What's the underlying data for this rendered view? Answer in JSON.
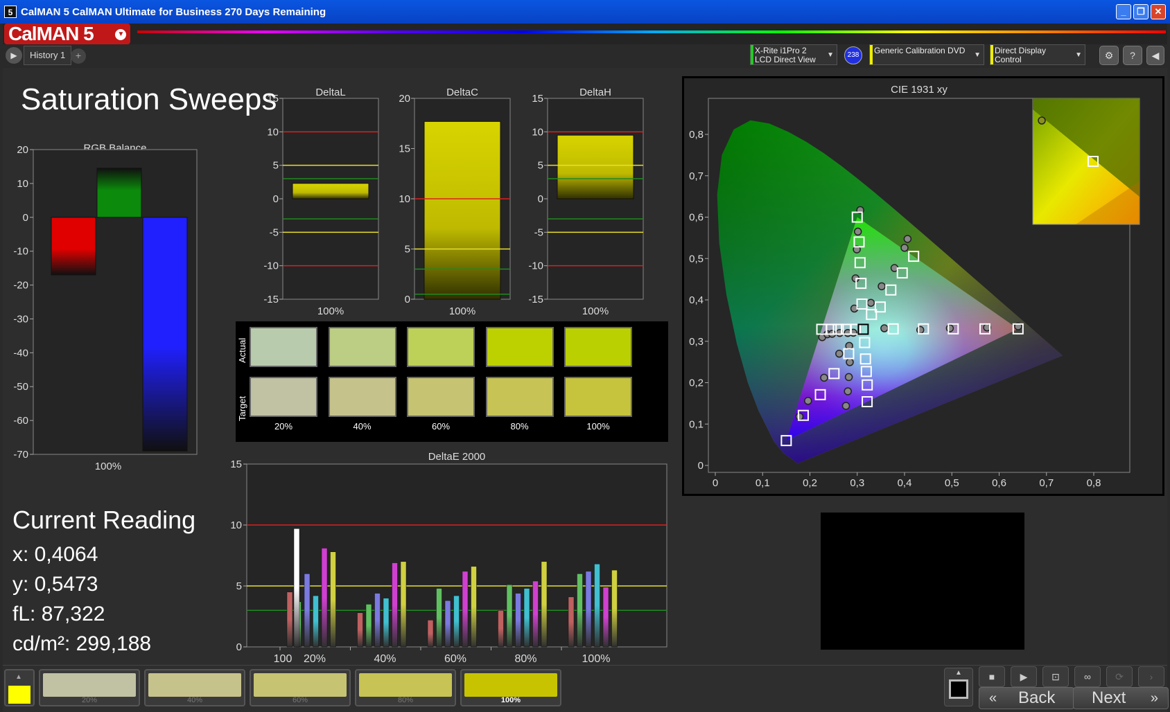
{
  "window": {
    "title": "CalMAN 5 CalMAN Ultimate for Business 270 Days Remaining",
    "app_icon": "5",
    "minimize": "_",
    "maximize": "❐",
    "close": "✕"
  },
  "logo": {
    "text": "CalMAN 5"
  },
  "tabs": [
    {
      "label": "History 1"
    }
  ],
  "devices": {
    "meter": {
      "line1": "X-Rite i1Pro 2",
      "line2": "LCD Direct View",
      "badge": "238",
      "color": "#22cc22"
    },
    "source": {
      "line1": "Generic Calibration DVD",
      "color": "#eeee00"
    },
    "display": {
      "line1": "Direct Display Control",
      "color": "#eeee00"
    }
  },
  "icons": {
    "settings": "gear-icon",
    "help": "?",
    "collapse": "chevron-left-icon"
  },
  "page": {
    "title": "Saturation Sweeps"
  },
  "rgb_balance": {
    "title": "RGB Balance",
    "ylim": [
      -70,
      20
    ],
    "yticks": [
      "20",
      "10",
      "0",
      "-10",
      "-20",
      "-30",
      "-40",
      "-50",
      "-60",
      "-70"
    ],
    "category": "100%",
    "bars": [
      {
        "name": "red",
        "value": -17,
        "color": "#e00000"
      },
      {
        "name": "green",
        "value": 14.5,
        "color": "#0b8a0b"
      },
      {
        "name": "blue",
        "value": -69,
        "color": "#2020ff"
      }
    ]
  },
  "delta_charts": [
    {
      "title": "DeltaL",
      "ylim": [
        -15,
        15
      ],
      "yticks": [
        "15",
        "10",
        "5",
        "0",
        "-5",
        "-10",
        "-15"
      ],
      "value": 2.3,
      "category": "100%"
    },
    {
      "title": "DeltaC",
      "ylim": [
        0,
        20
      ],
      "yticks": [
        "20",
        "15",
        "10",
        "5",
        "0"
      ],
      "value": 17.7,
      "category": "100%"
    },
    {
      "title": "DeltaH",
      "ylim": [
        -15,
        15
      ],
      "yticks": [
        "15",
        "10",
        "5",
        "0",
        "-5",
        "-10",
        "-15"
      ],
      "value": 9.5,
      "category": "100%"
    }
  ],
  "swatch_grid": {
    "row_labels": [
      "Actual",
      "Target"
    ],
    "columns": [
      "20%",
      "40%",
      "60%",
      "80%",
      "100%"
    ],
    "actual": [
      "#b9cbad",
      "#bccd84",
      "#bdd057",
      "#bdd000",
      "#bad000"
    ],
    "target": [
      "#c1c1a4",
      "#c6c28c",
      "#c6c372",
      "#c7c355",
      "#c6c33c"
    ]
  },
  "deltae": {
    "title": "DeltaE 2000",
    "ylim": [
      0,
      15
    ],
    "yticks": [
      "15",
      "10",
      "5",
      "0"
    ],
    "categories": [
      "100",
      "20%",
      "40%",
      "60%",
      "80%",
      "100%"
    ],
    "reference_lines": [
      10,
      5,
      3
    ]
  },
  "chart_data": [
    {
      "type": "bar",
      "title": "DeltaE 2000",
      "categories": [
        "100",
        "20%",
        "40%",
        "60%",
        "80%",
        "100%"
      ],
      "ylim": [
        0,
        15
      ],
      "series": [
        {
          "values": [
            null,
            4.5,
            2.8,
            2.2,
            3.0,
            4.1
          ],
          "color": "#c06060"
        },
        {
          "values": [
            null,
            3.7,
            3.5,
            4.8,
            5.1,
            6.0
          ],
          "color": "#60c060"
        },
        {
          "values": [
            null,
            6.0,
            4.4,
            3.8,
            4.4,
            6.2
          ],
          "color": "#7a7ae0"
        },
        {
          "values": [
            null,
            4.2,
            4.0,
            4.2,
            4.8,
            6.8
          ],
          "color": "#40c0d0"
        },
        {
          "values": [
            null,
            8.1,
            6.9,
            6.2,
            5.4,
            4.9
          ],
          "color": "#d040d0"
        },
        {
          "values": [
            null,
            7.8,
            7.0,
            6.6,
            7.0,
            6.3
          ],
          "color": "#d0d040"
        },
        {
          "values": [
            9.7,
            null,
            null,
            null,
            null,
            null
          ],
          "color": "#ffffff"
        }
      ]
    },
    {
      "type": "scatter",
      "title": "CIE 1931 xy",
      "xlim": [
        0,
        0.8
      ],
      "ylim": [
        0,
        0.85
      ],
      "xticks": [
        "0",
        "0,1",
        "0,2",
        "0,3",
        "0,4",
        "0,5",
        "0,6",
        "0,7",
        "0,8"
      ],
      "yticks": [
        "0",
        "0,1",
        "0,2",
        "0,3",
        "0,4",
        "0,5",
        "0,6",
        "0,7",
        "0,8"
      ],
      "gamut": [
        [
          0.64,
          0.33
        ],
        [
          0.3,
          0.6
        ],
        [
          0.15,
          0.06
        ]
      ],
      "white": [
        0.3127,
        0.329
      ],
      "targets": [
        [
          0.3,
          0.6
        ],
        [
          0.304,
          0.54
        ],
        [
          0.306,
          0.49
        ],
        [
          0.308,
          0.44
        ],
        [
          0.31,
          0.39
        ],
        [
          0.15,
          0.06
        ],
        [
          0.186,
          0.121
        ],
        [
          0.222,
          0.171
        ],
        [
          0.251,
          0.222
        ],
        [
          0.282,
          0.27
        ],
        [
          0.64,
          0.33
        ],
        [
          0.57,
          0.33
        ],
        [
          0.503,
          0.33
        ],
        [
          0.44,
          0.33
        ],
        [
          0.376,
          0.33
        ],
        [
          0.4193,
          0.5053
        ],
        [
          0.3952,
          0.4651
        ],
        [
          0.3711,
          0.4239
        ],
        [
          0.3486,
          0.3829
        ],
        [
          0.3301,
          0.3647
        ],
        [
          0.321,
          0.154
        ],
        [
          0.3212,
          0.1946
        ],
        [
          0.3192,
          0.227
        ],
        [
          0.3175,
          0.2573
        ],
        [
          0.3156,
          0.2969
        ],
        [
          0.225,
          0.329
        ],
        [
          0.245,
          0.329
        ],
        [
          0.26,
          0.329
        ],
        [
          0.277,
          0.329
        ],
        [
          0.296,
          0.329
        ]
      ],
      "measured": [
        [
          0.3064,
          0.617
        ],
        [
          0.3014,
          0.565
        ],
        [
          0.2991,
          0.522
        ],
        [
          0.2965,
          0.452
        ],
        [
          0.2939,
          0.379
        ],
        [
          0.178,
          0.118
        ],
        [
          0.196,
          0.156
        ],
        [
          0.23,
          0.212
        ],
        [
          0.262,
          0.27
        ],
        [
          0.283,
          0.289
        ],
        [
          0.6402,
          0.3361
        ],
        [
          0.5745,
          0.3334
        ],
        [
          0.4958,
          0.3314
        ],
        [
          0.4333,
          0.3274
        ],
        [
          0.3573,
          0.3313
        ],
        [
          0.4064,
          0.5473
        ],
        [
          0.4,
          0.5259
        ],
        [
          0.3788,
          0.4769
        ],
        [
          0.3517,
          0.4329
        ],
        [
          0.3288,
          0.3929
        ],
        [
          0.2762,
          0.144
        ],
        [
          0.2802,
          0.1791
        ],
        [
          0.2822,
          0.2135
        ],
        [
          0.2843,
          0.2495
        ],
        [
          0.2918,
          0.3207
        ],
        [
          0.226,
          0.31
        ],
        [
          0.237,
          0.317
        ],
        [
          0.247,
          0.318
        ],
        [
          0.263,
          0.32
        ],
        [
          0.28,
          0.32
        ]
      ]
    }
  ],
  "current_reading": {
    "title": "Current Reading",
    "x": "x: 0,4064",
    "y": "y: 0,5473",
    "fl": "fL: 87,322",
    "cdm2": "cd/m²: 299,188"
  },
  "bottom": {
    "current_color": "#ffff00",
    "swatches": [
      {
        "label": "20%",
        "color": "#c1c1a4",
        "active": false
      },
      {
        "label": "40%",
        "color": "#c6c28c",
        "active": false
      },
      {
        "label": "60%",
        "color": "#c6c372",
        "active": false
      },
      {
        "label": "80%",
        "color": "#c7c355",
        "active": false
      },
      {
        "label": "100%",
        "color": "#c7c300",
        "active": true
      }
    ],
    "back": "Back",
    "next": "Next"
  }
}
